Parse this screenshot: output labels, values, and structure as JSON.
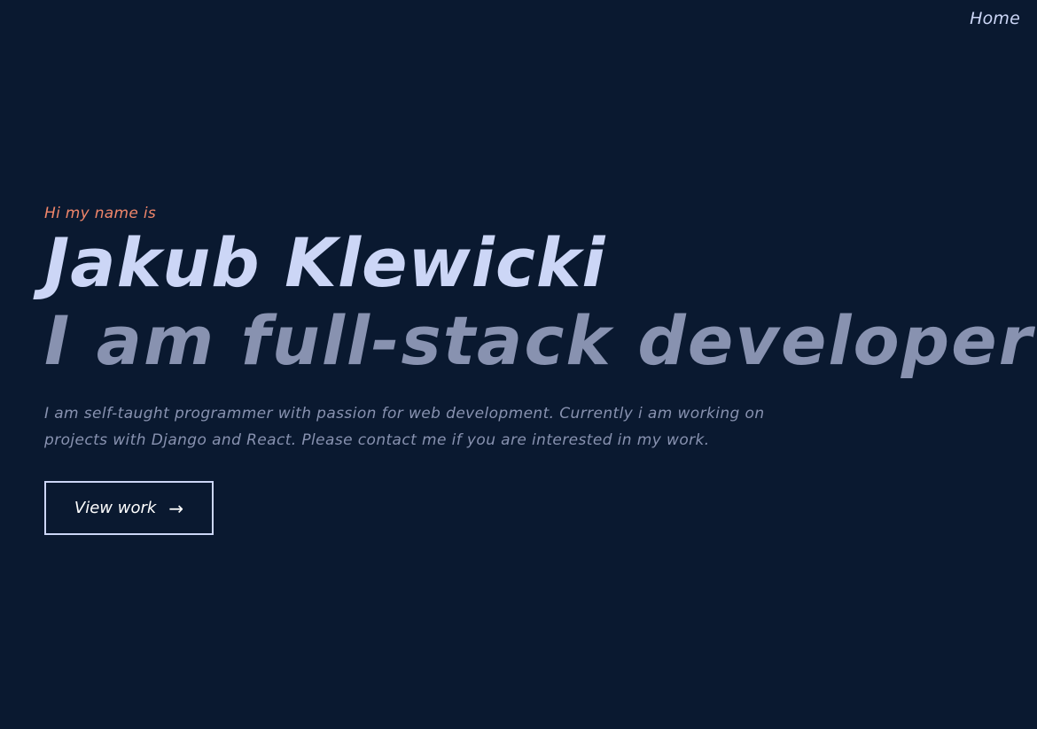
{
  "nav": {
    "home_label": "Home"
  },
  "hero": {
    "greeting": "Hi my name is",
    "name": "Jakub Klewicki",
    "role": "I am full-stack developer",
    "bio": "I am self-taught programmer with passion for web development. Currently i am working on projects with Django and React. Please contact me if you are interested in my work.",
    "cta_label": "View work",
    "cta_icon": "→"
  },
  "colors": {
    "background": "#0a1930",
    "accent": "#f0866a",
    "heading": "#ccd6f6",
    "muted": "#8892b0"
  }
}
